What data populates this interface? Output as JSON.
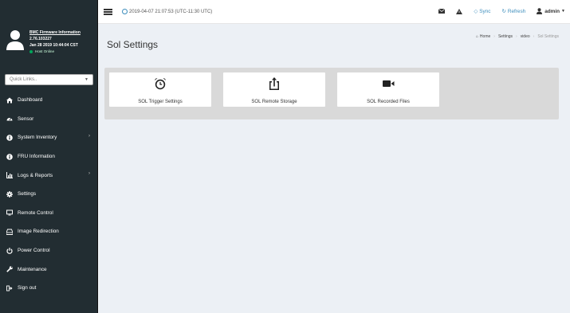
{
  "sidebar": {
    "firmware_title": "BMC Firmware Information",
    "firmware_version": "2.76.103227",
    "firmware_date": "Jan 28 2019 10:44:04 CST",
    "host_status": "Host Online",
    "quick_links_placeholder": "Quick Links..",
    "items": [
      {
        "label": "Dashboard",
        "icon": "dashboard-icon",
        "has_children": false
      },
      {
        "label": "Sensor",
        "icon": "tachometer-icon",
        "has_children": false
      },
      {
        "label": "System Inventory",
        "icon": "info-icon",
        "has_children": true
      },
      {
        "label": "FRU Information",
        "icon": "info-icon",
        "has_children": false
      },
      {
        "label": "Logs & Reports",
        "icon": "bar-chart-icon",
        "has_children": true
      },
      {
        "label": "Settings",
        "icon": "gear-icon",
        "has_children": false
      },
      {
        "label": "Remote Control",
        "icon": "monitor-icon",
        "has_children": false
      },
      {
        "label": "Image Redirection",
        "icon": "hdd-icon",
        "has_children": false
      },
      {
        "label": "Power Control",
        "icon": "power-icon",
        "has_children": false
      },
      {
        "label": "Maintenance",
        "icon": "wrench-icon",
        "has_children": false
      },
      {
        "label": "Sign out",
        "icon": "sign-out-icon",
        "has_children": false
      }
    ]
  },
  "topbar": {
    "datetime": "2019-04-07 21:07:53 (UTC-11:30 UTC)",
    "sync_label": "Sync",
    "refresh_label": "Refresh",
    "user_label": "admin"
  },
  "page": {
    "title": "Sol Settings",
    "breadcrumb": [
      "Home",
      "Settings",
      "video",
      "Sol Settings"
    ]
  },
  "cards": [
    {
      "label": "SOL Trigger Settings",
      "icon": "alarm-clock-icon"
    },
    {
      "label": "SOL Remote Storage",
      "icon": "upload-icon"
    },
    {
      "label": "SOL Recorded Files",
      "icon": "video-camera-icon"
    }
  ],
  "colors": {
    "sidebar_bg": "#222d32",
    "accent": "#3c8dbc",
    "online": "#00a65a"
  }
}
